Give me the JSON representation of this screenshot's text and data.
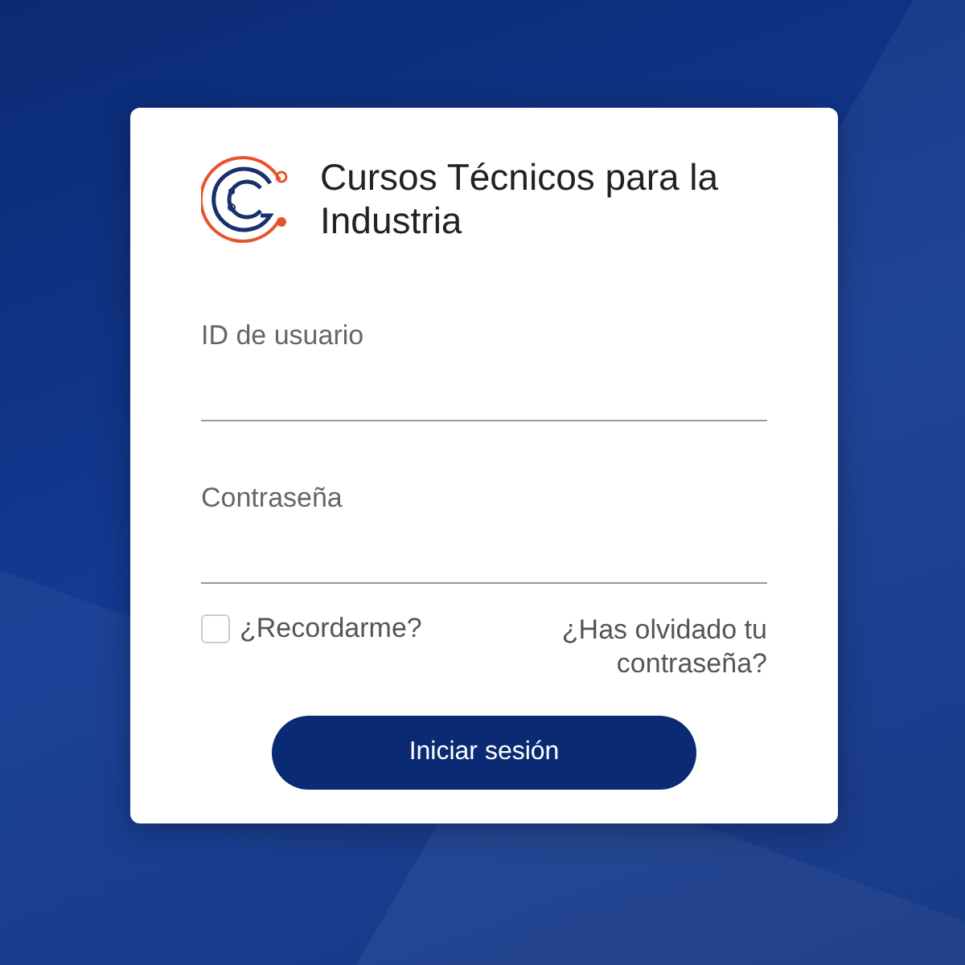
{
  "brand": {
    "title": "Cursos Técnicos para la Industria"
  },
  "fields": [
    {
      "label": "ID de usuario"
    },
    {
      "label": "Contraseña"
    }
  ],
  "remember": {
    "label": "¿Recordarme?",
    "checked": false
  },
  "forgot_link": "¿Has olvidado tu contraseña?",
  "submit": "Iniciar sesión"
}
